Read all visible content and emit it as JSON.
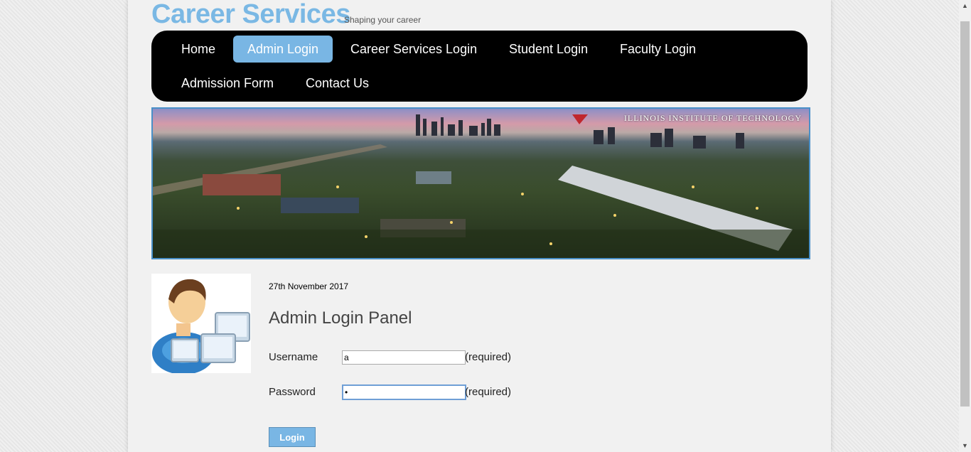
{
  "header": {
    "logo": "Career Services",
    "tagline": "Shaping your career"
  },
  "nav": {
    "items": [
      {
        "label": "Home"
      },
      {
        "label": "Admin Login"
      },
      {
        "label": "Career Services Login"
      },
      {
        "label": "Student Login"
      },
      {
        "label": "Faculty Login"
      },
      {
        "label": "Admission Form"
      },
      {
        "label": "Contact Us"
      }
    ]
  },
  "banner": {
    "caption": "ILLINOIS INSTITUTE OF TECHNOLOGY"
  },
  "panel": {
    "date": "27th November 2017",
    "title": "Admin Login Panel",
    "username_label": "Username",
    "username_value": "a",
    "password_label": "Password",
    "password_value": "•",
    "required_text": "(required)",
    "login_label": "Login"
  },
  "colors": {
    "accent": "#79b6e4",
    "nav_bg": "#000000"
  }
}
